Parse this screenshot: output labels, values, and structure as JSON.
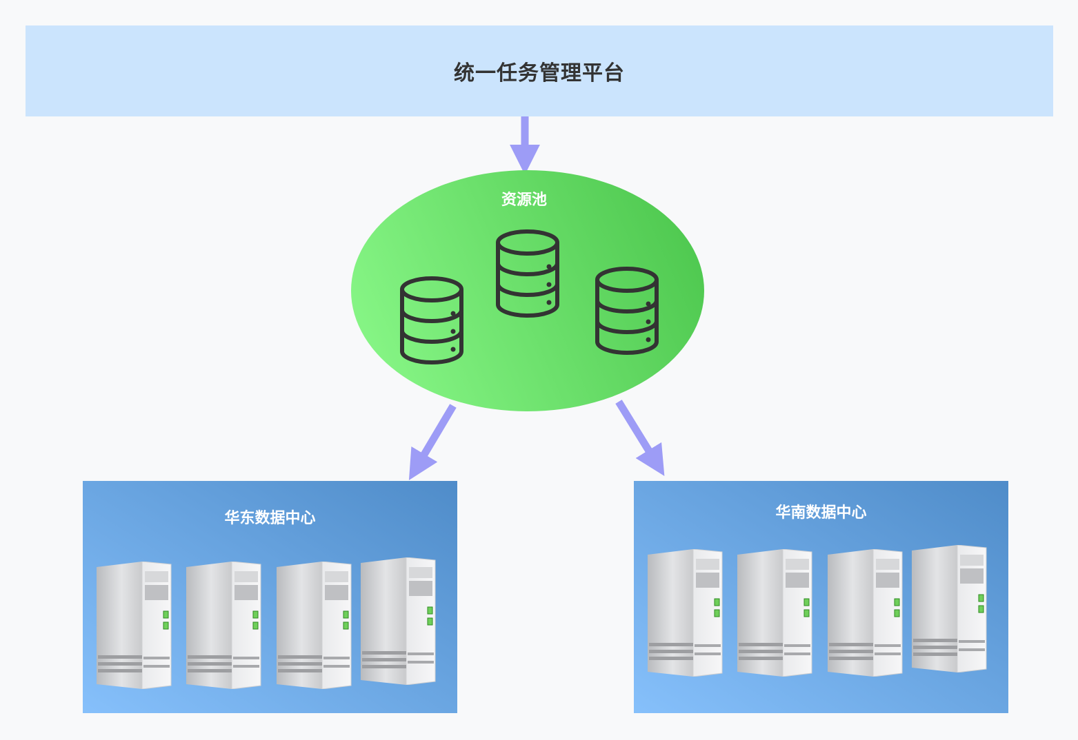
{
  "platform": {
    "title": "统一任务管理平台"
  },
  "resource_pool": {
    "title": "资源池",
    "database_count": 3
  },
  "datacenters": [
    {
      "title": "华东数据中心",
      "server_count": 4
    },
    {
      "title": "华南数据中心",
      "server_count": 4
    }
  ],
  "colors": {
    "platform_bg": "#cbe4fd",
    "pool_green_light": "#86f585",
    "pool_green_dark": "#4ec84f",
    "arrow": "#9d9cf6",
    "dc_blue_light": "#86c0fb",
    "dc_blue_dark": "#4f8cc9"
  }
}
